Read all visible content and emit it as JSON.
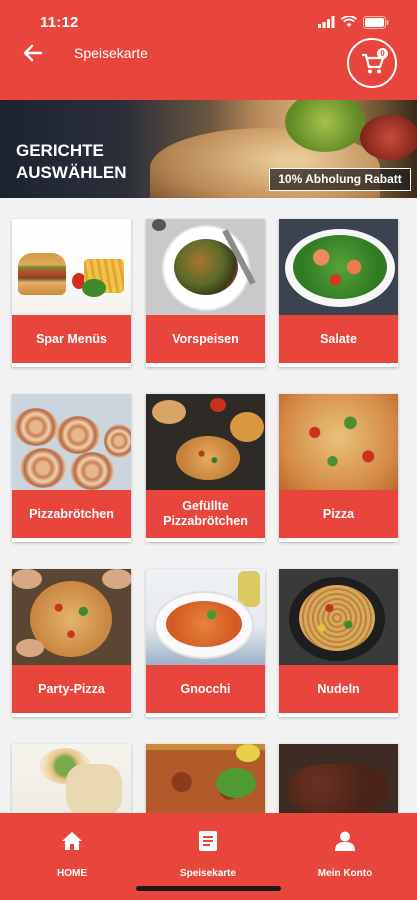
{
  "status_bar": {
    "time": "11:12"
  },
  "header": {
    "title": "Speisekarte",
    "cart_count": "0"
  },
  "banner": {
    "heading_line1": "GERICHTE",
    "heading_line2": "AUSWÄHLEN",
    "badge": "10% Abholung Rabatt"
  },
  "categories": [
    {
      "label": "Spar Menüs",
      "image": "burger-fries-photo"
    },
    {
      "label": "Vorspeisen",
      "image": "antipasti-plate-photo"
    },
    {
      "label": "Salate",
      "image": "shrimp-salad-photo"
    },
    {
      "label": "Pizzabrötchen",
      "image": "pizza-rolls-photo"
    },
    {
      "label": "Gefüllte Pizzabrötchen",
      "image": "stuffed-pizza-rolls-photo"
    },
    {
      "label": "Pizza",
      "image": "pizza-photo"
    },
    {
      "label": "Party-Pizza",
      "image": "party-pizza-photo"
    },
    {
      "label": "Gnocchi",
      "image": "gnocchi-bowl-photo"
    },
    {
      "label": "Nudeln",
      "image": "noodles-pan-photo"
    },
    {
      "label": "",
      "image": "wraps-photo"
    },
    {
      "label": "",
      "image": "lahmacun-photo"
    },
    {
      "label": "",
      "image": "grilled-meat-photo"
    }
  ],
  "bottom_nav": [
    {
      "label": "HOME",
      "icon": "home-icon"
    },
    {
      "label": "Speisekarte",
      "icon": "menu-icon"
    },
    {
      "label": "Mein Konto",
      "icon": "user-icon"
    }
  ],
  "colors": {
    "accent": "#e8453c",
    "background": "#f2f2f2"
  }
}
